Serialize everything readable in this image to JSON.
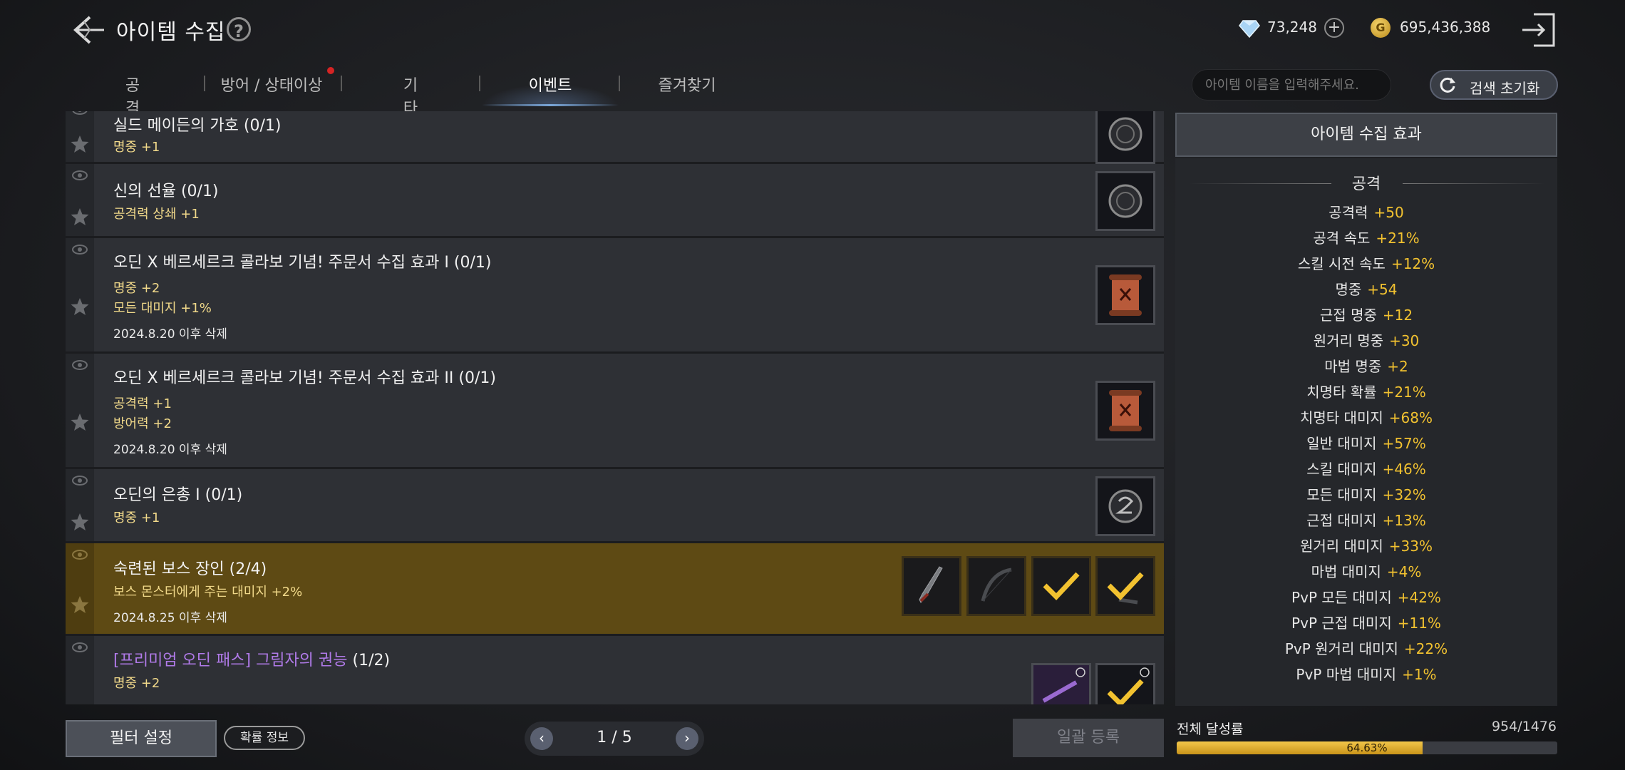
{
  "header": {
    "title": "아이템 수집",
    "help": "?",
    "gems": "73,248",
    "gold": "695,436,388",
    "gold_symbol": "G"
  },
  "tabs": [
    {
      "label": "공격"
    },
    {
      "label": "방어 / 상태이상"
    },
    {
      "label": "기타"
    },
    {
      "label": "이벤트"
    },
    {
      "label": "즐겨찾기"
    }
  ],
  "search": {
    "placeholder": "아이템 이름을 입력해주세요.",
    "reset_label": "검색 초기화"
  },
  "items": [
    {
      "title": "실드 메이든의 가호 (0/1)",
      "effects": [
        "명중 +1"
      ],
      "note": ""
    },
    {
      "title": "신의 선율 (0/1)",
      "effects": [
        "공격력 상쇄 +1"
      ],
      "note": ""
    },
    {
      "title": "오딘 X 베르세르크 콜라보 기념! 주문서 수집 효과 I (0/1)",
      "effects": [
        "명중 +2",
        "모든 대미지 +1%"
      ],
      "note": "2024.8.20 이후 삭제"
    },
    {
      "title": "오딘 X 베르세르크 콜라보 기념! 주문서 수집 효과 II (0/1)",
      "effects": [
        "공격력 +1",
        "방어력 +2"
      ],
      "note": "2024.8.20 이후 삭제"
    },
    {
      "title": "오딘의 은총 I  (0/1)",
      "effects": [
        "명중 +1"
      ],
      "note": ""
    },
    {
      "title": "숙련된 보스 장인 (2/4)",
      "effects": [
        "보스 몬스터에게 주는 대미지 +2%"
      ],
      "note": "2024.8.25 이후 삭제"
    },
    {
      "title_purple": "[프리미엄 오딘 패스] 그림자의 권능",
      "title_rest": " (1/2)",
      "effects": [
        "명중 +2"
      ],
      "note": ""
    }
  ],
  "effects_panel": {
    "title": "아이템 수집 효과",
    "category": "공격",
    "stats": [
      {
        "name": "공격력",
        "value": "+50"
      },
      {
        "name": "공격 속도",
        "value": "+21%"
      },
      {
        "name": "스킬 시전 속도",
        "value": "+12%"
      },
      {
        "name": "명중",
        "value": "+54"
      },
      {
        "name": "근접 명중",
        "value": "+12"
      },
      {
        "name": "원거리 명중",
        "value": "+30"
      },
      {
        "name": "마법 명중",
        "value": "+2"
      },
      {
        "name": "치명타 확률",
        "value": "+21%"
      },
      {
        "name": "치명타 대미지",
        "value": "+68%"
      },
      {
        "name": "일반 대미지",
        "value": "+57%"
      },
      {
        "name": "스킬 대미지",
        "value": "+46%"
      },
      {
        "name": "모든 대미지",
        "value": "+32%"
      },
      {
        "name": "근접 대미지",
        "value": "+13%"
      },
      {
        "name": "원거리 대미지",
        "value": "+33%"
      },
      {
        "name": "마법 대미지",
        "value": "+4%"
      },
      {
        "name": "PvP 모든 대미지",
        "value": "+42%"
      },
      {
        "name": "PvP 근접 대미지",
        "value": "+11%"
      },
      {
        "name": "PvP 원거리 대미지",
        "value": "+22%"
      },
      {
        "name": "PvP 마법 대미지",
        "value": "+1%"
      }
    ]
  },
  "footer": {
    "filter_label": "필터 설정",
    "prob_label": "확률 정보",
    "page": "1 / 5",
    "bulk_label": "일괄 등록",
    "rate_label": "전체 달성률",
    "rate_count": "954/1476",
    "rate_pct": "64.63%",
    "rate_fraction": 0.6463
  },
  "colors": {
    "accent_gold": "#f2c230",
    "active_row": "#5e4a14",
    "purple_title": "#b07ae8"
  }
}
